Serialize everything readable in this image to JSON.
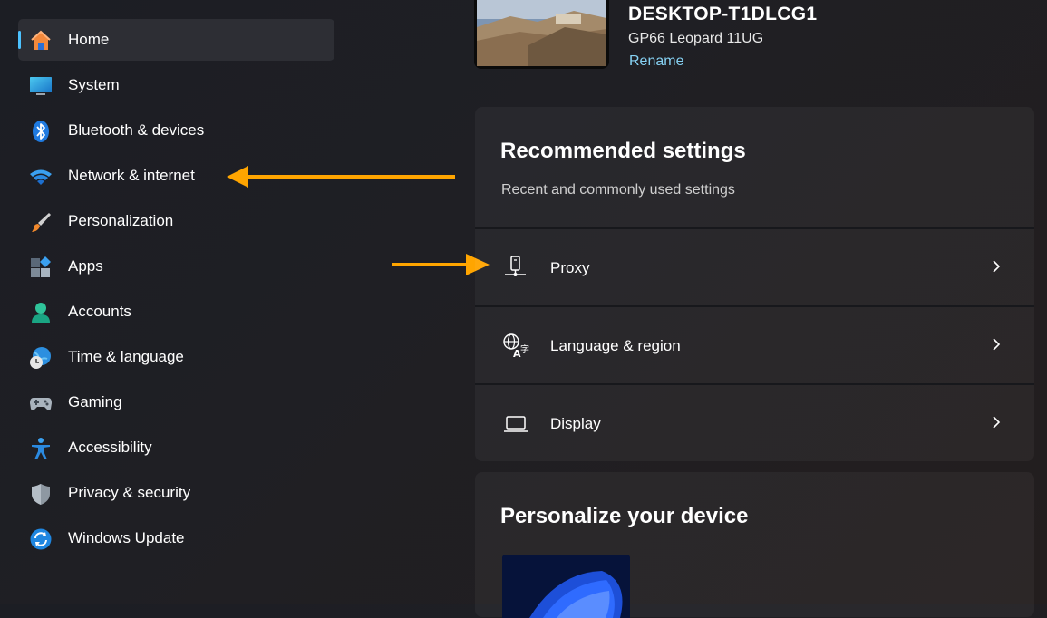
{
  "sidebar": {
    "items": [
      {
        "label": "Home",
        "icon": "home-icon"
      },
      {
        "label": "System",
        "icon": "system-icon"
      },
      {
        "label": "Bluetooth & devices",
        "icon": "bluetooth-icon"
      },
      {
        "label": "Network & internet",
        "icon": "wifi-icon"
      },
      {
        "label": "Personalization",
        "icon": "brush-icon"
      },
      {
        "label": "Apps",
        "icon": "apps-icon"
      },
      {
        "label": "Accounts",
        "icon": "account-icon"
      },
      {
        "label": "Time & language",
        "icon": "globe-clock-icon"
      },
      {
        "label": "Gaming",
        "icon": "gamepad-icon"
      },
      {
        "label": "Accessibility",
        "icon": "accessibility-icon"
      },
      {
        "label": "Privacy & security",
        "icon": "shield-icon"
      },
      {
        "label": "Windows Update",
        "icon": "update-icon"
      }
    ],
    "active_index": 0
  },
  "device": {
    "name": "DESKTOP-T1DLCG1",
    "model": "GP66 Leopard 11UG",
    "rename_label": "Rename"
  },
  "recommended": {
    "title": "Recommended settings",
    "subtitle": "Recent and commonly used settings",
    "rows": [
      {
        "label": "Proxy",
        "icon": "proxy-icon"
      },
      {
        "label": "Language & region",
        "icon": "language-icon"
      },
      {
        "label": "Display",
        "icon": "laptop-icon"
      }
    ]
  },
  "personalize": {
    "title": "Personalize your device"
  },
  "colors": {
    "accent": "#4cc2ff",
    "annotation_arrow": "#ffa500",
    "link": "#86d1f3"
  }
}
